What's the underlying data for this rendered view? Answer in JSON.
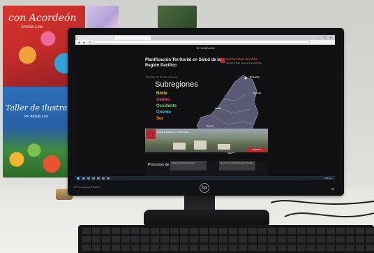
{
  "posters": {
    "top_title": "con Acordeón",
    "top_author": "Amalia Low",
    "mid_title": "Taller de ilustración",
    "mid_author": "con Amalia Low"
  },
  "browser": {
    "tabs": [
      "",
      ""
    ],
    "url": ""
  },
  "page": {
    "live_label": "En Construcción",
    "title": "Planificación Territorial en Salud de la Región Pacífico",
    "university": {
      "name": "Universidad del Valle",
      "subtitle": "Facultad de Salud · Escuela de Salud Pública"
    },
    "department_label": "Departamento del Valle del Cauca",
    "subregions_title": "Subregiones",
    "subregions": [
      {
        "name": "Norte",
        "color": "#f0d23a"
      },
      {
        "name": "Centro",
        "color": "#e9546f"
      },
      {
        "name": "Occidente",
        "color": "#7ad16a"
      },
      {
        "name": "Oriente",
        "color": "#4fc7e6"
      },
      {
        "name": "Sur",
        "color": "#f39a34"
      }
    ],
    "map_cities": [
      "Risaralda",
      "Quindío",
      "Chocó",
      "Océano",
      "Pacífico"
    ],
    "photo_caption": "Instituto de Educación en Salud Pública",
    "register_label": "Registrar",
    "processes_title": "Procesos de interés",
    "process_cards": [
      "Refuerzo al sistema de salud",
      "Refuerzo a la red de Educación Superior"
    ]
  },
  "taskbar": {
    "clock": "4:38 p.m."
  },
  "monitor": {
    "brand": "HP Compaq LE2202x",
    "logo": "hp"
  },
  "colors": {
    "accent_red": "#c6262e",
    "page_bg": "#101012"
  }
}
